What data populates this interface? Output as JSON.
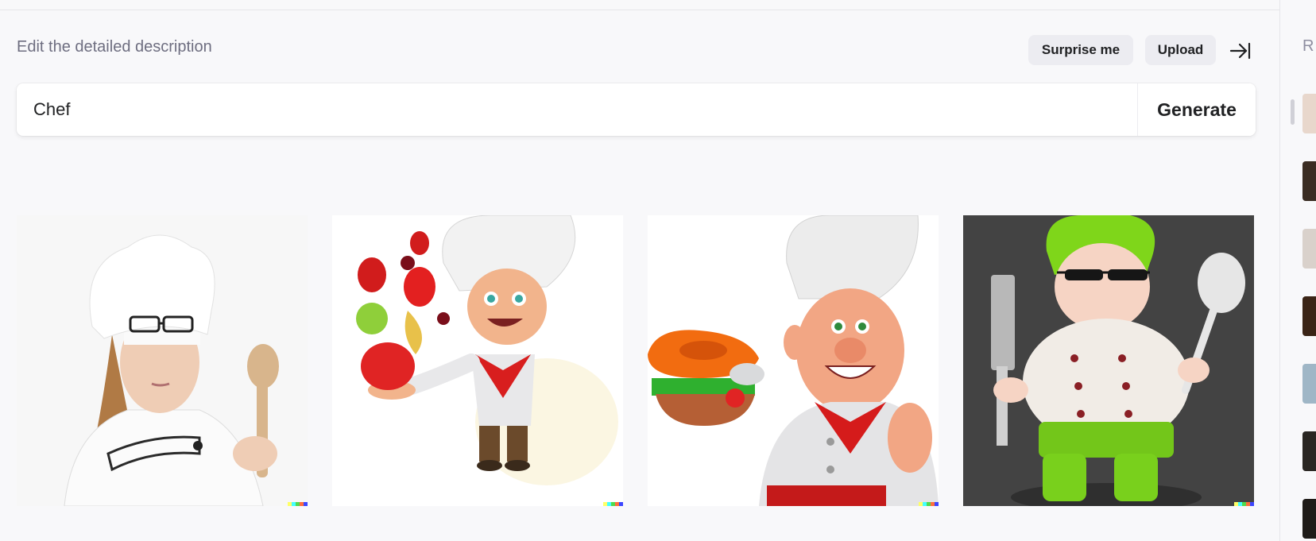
{
  "header": {
    "label": "Edit the detailed description",
    "surprise_label": "Surprise me",
    "upload_label": "Upload",
    "collapse_icon": "collapse-right-icon"
  },
  "prompt": {
    "value": "Chef",
    "generate_label": "Generate"
  },
  "results": [
    {
      "name": "chef-photo-woman-spoon"
    },
    {
      "name": "cartoon-chef-fruits"
    },
    {
      "name": "cartoon-chef-burger"
    },
    {
      "name": "3d-chef-green-hat"
    }
  ],
  "history_panel": {
    "letter": "R"
  },
  "colors": {
    "background": "#f8f8fa",
    "chip": "#ececf1",
    "text": "#202123",
    "muted": "#6e6e80"
  }
}
